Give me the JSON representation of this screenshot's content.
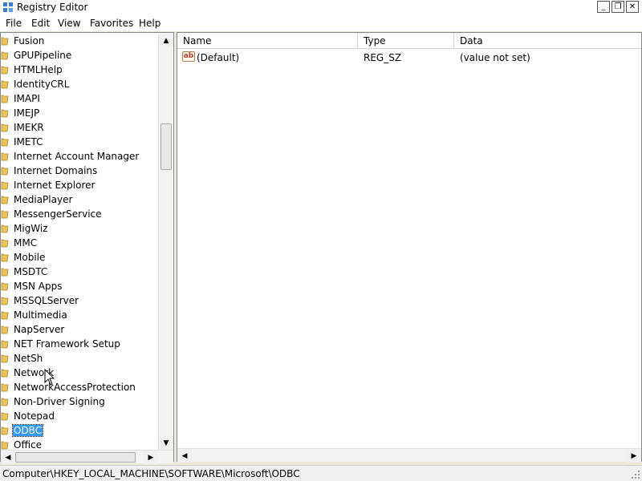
{
  "window": {
    "title": "Registry Editor",
    "min_glyph": "_",
    "max_glyph": "❐",
    "close_glyph": "✕"
  },
  "menu": {
    "items": [
      "File",
      "Edit",
      "View",
      "Favorites",
      "Help"
    ]
  },
  "tree": {
    "items": [
      {
        "label": "Fusion"
      },
      {
        "label": "GPUPipeline"
      },
      {
        "label": "HTMLHelp"
      },
      {
        "label": "IdentityCRL"
      },
      {
        "label": "IMAPI"
      },
      {
        "label": "IMEJP"
      },
      {
        "label": "IMEKR"
      },
      {
        "label": "IMETC"
      },
      {
        "label": "Internet Account Manager"
      },
      {
        "label": "Internet Domains"
      },
      {
        "label": "Internet Explorer"
      },
      {
        "label": "MediaPlayer"
      },
      {
        "label": "MessengerService"
      },
      {
        "label": "MigWiz"
      },
      {
        "label": "MMC"
      },
      {
        "label": "Mobile"
      },
      {
        "label": "MSDTC"
      },
      {
        "label": "MSN Apps"
      },
      {
        "label": "MSSQLServer"
      },
      {
        "label": "Multimedia"
      },
      {
        "label": "NapServer"
      },
      {
        "label": "NET Framework Setup"
      },
      {
        "label": "NetSh"
      },
      {
        "label": "Network"
      },
      {
        "label": "NetworkAccessProtection"
      },
      {
        "label": "Non-Driver Signing"
      },
      {
        "label": "Notepad"
      },
      {
        "label": "ODBC",
        "selected": true
      },
      {
        "label": "Office"
      }
    ]
  },
  "list": {
    "columns": {
      "name": "Name",
      "type": "Type",
      "data": "Data"
    },
    "rows": [
      {
        "name": "(Default)",
        "type": "REG_SZ",
        "data": "(value not set)",
        "icon": "ab-string-icon"
      }
    ]
  },
  "scroll_glyphs": {
    "up": "▲",
    "down": "▼",
    "left": "◀",
    "right": "▶"
  },
  "status": {
    "path": "Computer\\HKEY_LOCAL_MACHINE\\SOFTWARE\\Microsoft\\ODBC"
  },
  "colors": {
    "selection": "#3399ff",
    "folder": "#e8c25a"
  }
}
